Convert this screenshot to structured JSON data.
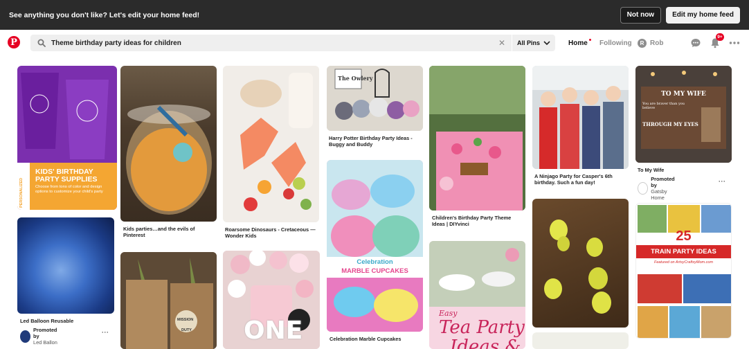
{
  "banner": {
    "message": "See anything you don't like? Let's edit your home feed!",
    "not_now": "Not now",
    "edit_feed": "Edit my home feed"
  },
  "header": {
    "logo": "P",
    "search_value": "Theme birthday party ideas for children",
    "all_pins": "All Pins",
    "nav_home": "Home",
    "nav_following": "Following",
    "profile_initial": "R",
    "profile_name": "Rob",
    "notification_badge": "9+"
  },
  "pins": {
    "p1": {
      "overlay_title": "KIDS' BIRTHDAY PARTY SUPPLIES",
      "overlay_sub": "Choose from tons of color and design options to customize your child's party",
      "side_tag": "PERSONALIZED"
    },
    "p2": {
      "title": "Led Balloon Reusable",
      "promoted": "Promoted by",
      "advertiser": "Led Ballon"
    },
    "p3": {
      "title": "Kids parties…and the evils of Pinterest"
    },
    "p4": {
      "overlay": "MISSION",
      "overlay2": "DUTY"
    },
    "p5": {
      "title": "Roarsome Dinosaurs - Cretaceous — Wonder Kids"
    },
    "p6": {
      "overlay": "ONE"
    },
    "p7": {
      "title": "Harry Potter Birthday Party Ideas - Buggy and Buddy",
      "sign": "The Owlery"
    },
    "p8": {
      "banner_1": "Celebration",
      "banner_2": "MARBLE CUPCAKES",
      "title": "Celebration Marble Cupcakes"
    },
    "p9": {
      "title": "Children's Birthday Party Theme Ideas | DIYvinci"
    },
    "p10": {
      "overlay_small": "Easy",
      "overlay_big": "Tea Party",
      "overlay_big2": "Ideas &"
    },
    "p11": {
      "title": "A Ninjago Party for Casper's 6th birthday. Such a fun day!"
    },
    "p13": {
      "title": "To My Wife",
      "promoted": "Promoted by",
      "advertiser": "Gatsby Home",
      "sign_title": "TO MY WIFE",
      "sign_line": "THROUGH MY EYES",
      "sign_sub": "You are braver than you believe"
    },
    "p14": {
      "number": "25",
      "title": "TRAIN PARTY IDEAS",
      "sub": "Featured on ArtsyCraftsyMom.com"
    }
  },
  "colors": {
    "accent": "#e60023",
    "banner_bg": "#2b2b2b"
  }
}
